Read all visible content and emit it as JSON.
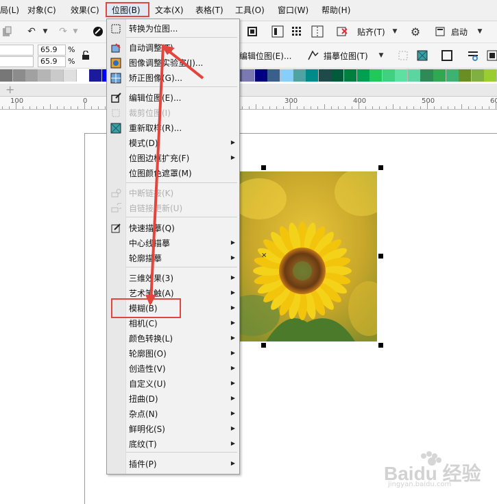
{
  "menubar": {
    "items": [
      "局(L)",
      "对象(C)",
      "效果(C)",
      "位图(B)",
      "文本(X)",
      "表格(T)",
      "工具(O)",
      "窗口(W)",
      "帮助(H)"
    ]
  },
  "toolbar": {
    "paste_label": "贴齐(T)",
    "launch_label": "启动"
  },
  "propbar": {
    "width_value": "65.9",
    "height_value": "65.9",
    "unit_top": "%",
    "unit_bottom": "%",
    "edit_bitmap_label": "编辑位图(E)...",
    "trace_bitmap_label": "描摹位图(T)"
  },
  "ruler": {
    "labels": [
      "100",
      "0",
      "300",
      "400",
      "500",
      "60"
    ]
  },
  "palette": {
    "colors": [
      "#777777",
      "#8c8c8c",
      "#a1a1a1",
      "#b5b5b5",
      "#cacaca",
      "#e0e0e0",
      "#ffffff",
      "#1a1a9e",
      "#0000ff",
      "#00a2e8",
      "#00ffff",
      "#00ff00",
      "#ffff00",
      "#ff0000",
      "#ff00ff",
      "#b0b0b0",
      "#7f7f7f",
      "#c0c0c0",
      "#5c5c8a",
      "#7a7ab0",
      "#000080",
      "#3a5f8c",
      "#87cefa",
      "#4fa3a3",
      "#008b8b",
      "#1e4a4a",
      "#005b3a",
      "#008040",
      "#00a050",
      "#22c85a",
      "#40d080",
      "#60e0a0",
      "#5cd6a0",
      "#2e8b57",
      "#2fa84f",
      "#3cb371",
      "#6b8e23",
      "#7fb040",
      "#9acd32"
    ]
  },
  "bitmap_menu": {
    "items": [
      {
        "label": "转换为位图...",
        "icon": "convert-bitmap-icon"
      },
      {
        "label": "自动调整(T)",
        "icon": "auto-adjust-icon"
      },
      {
        "label": "图像调整实验室(J)...",
        "icon": "image-lab-icon"
      },
      {
        "label": "矫正图像(G)...",
        "icon": "straighten-icon"
      },
      {
        "label": "编辑位图(E)...",
        "icon": "edit-bitmap-icon"
      },
      {
        "label": "裁剪位图(I)",
        "icon": "crop-bitmap-icon",
        "disabled": true
      },
      {
        "label": "重新取样(R)...",
        "icon": "resample-icon"
      },
      {
        "label": "模式(D)",
        "submenu": true
      },
      {
        "label": "位图边框扩充(F)",
        "submenu": true
      },
      {
        "label": "位图颜色遮罩(M)"
      },
      {
        "label": "中断链接(K)",
        "icon": "break-link-icon",
        "disabled": true
      },
      {
        "label": "自链接更新(U)",
        "icon": "update-link-icon",
        "disabled": true
      },
      {
        "label": "快速描摹(Q)",
        "icon": "quick-trace-icon"
      },
      {
        "label": "中心线描摹",
        "submenu": true
      },
      {
        "label": "轮廓描摹",
        "submenu": true
      },
      {
        "label": "三维效果(3)",
        "submenu": true
      },
      {
        "label": "艺术笔触(A)",
        "submenu": true
      },
      {
        "label": "模糊(B)",
        "submenu": true
      },
      {
        "label": "相机(C)",
        "submenu": true
      },
      {
        "label": "颜色转换(L)",
        "submenu": true
      },
      {
        "label": "轮廓图(O)",
        "submenu": true
      },
      {
        "label": "创造性(V)",
        "submenu": true
      },
      {
        "label": "自定义(U)",
        "submenu": true
      },
      {
        "label": "扭曲(D)",
        "submenu": true
      },
      {
        "label": "杂点(N)",
        "submenu": true
      },
      {
        "label": "鲜明化(S)",
        "submenu": true
      },
      {
        "label": "底纹(T)",
        "submenu": true
      },
      {
        "label": "插件(P)",
        "submenu": true
      }
    ]
  },
  "watermark": {
    "brand": "Baidu 经验",
    "url": "jingyan.baidu.com"
  },
  "colors": {
    "highlight": "#e2453c",
    "menu_bg": "#f2f2f2"
  }
}
